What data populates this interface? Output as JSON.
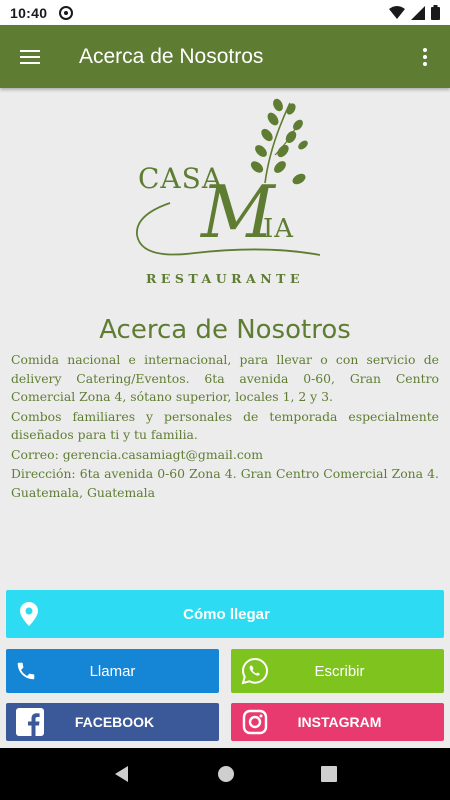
{
  "status_bar": {
    "time": "10:40"
  },
  "app_bar": {
    "title": "Acerca de Nosotros"
  },
  "logo": {
    "word1": "CASA",
    "word2": "M",
    "word3": "IA",
    "subtitle": "RESTAURANTE"
  },
  "content": {
    "title": "Acerca de Nosotros",
    "paragraphs": [
      "Comida nacional e internacional, para llevar o con servicio de delivery Catering/Eventos. 6ta avenida 0-60, Gran Centro Comercial Zona 4, sótano superior, locales 1, 2 y 3.",
      "Combos familiares y personales de temporada especialmente diseñados para ti y tu familia.",
      "Correo: gerencia.casamiagt@gmail.com",
      "Dirección: 6ta avenida 0-60 Zona 4. Gran Centro Comercial Zona 4. Guatemala, Guatemala"
    ]
  },
  "buttons": {
    "directions": "Cómo llegar",
    "call": "Llamar",
    "write": "Escribir",
    "facebook": "FACEBOOK",
    "instagram": "INSTAGRAM"
  },
  "colors": {
    "brand_green": "#5f7d32",
    "directions": "#2ddcf2",
    "call": "#1586d6",
    "write": "#7fc31f",
    "facebook": "#3b5999",
    "instagram": "#e93a6f"
  },
  "icons": [
    "menu-icon",
    "more-vert-icon",
    "location-pin-icon",
    "phone-icon",
    "whatsapp-icon",
    "facebook-icon",
    "instagram-icon",
    "wifi-icon",
    "signal-icon",
    "battery-icon",
    "back-icon",
    "home-icon",
    "recents-icon"
  ]
}
